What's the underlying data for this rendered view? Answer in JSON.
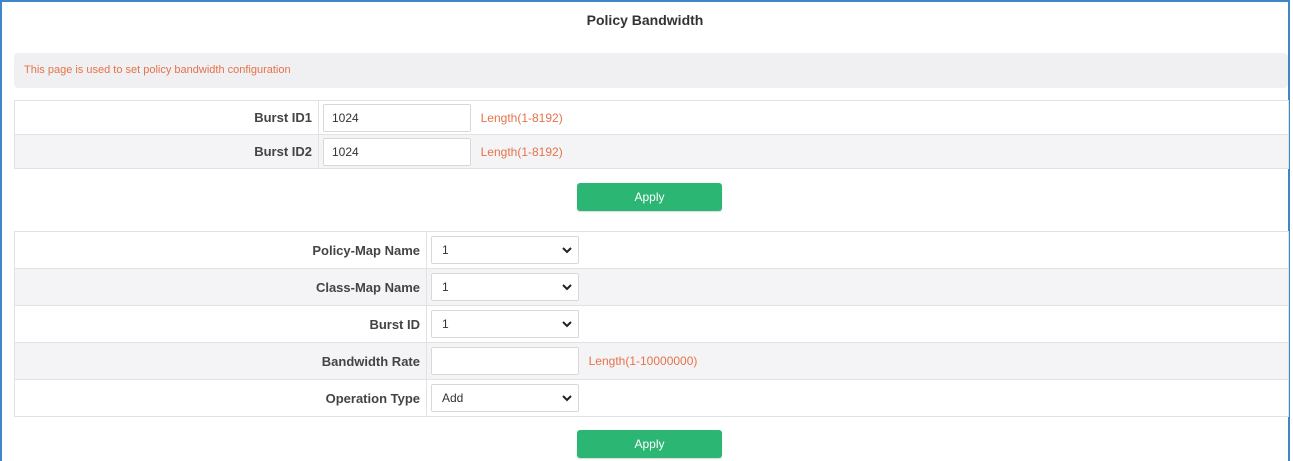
{
  "page": {
    "title": "Policy Bandwidth",
    "description": "This page is used to set policy bandwidth configuration"
  },
  "burst_form": {
    "rows": [
      {
        "label": "Burst ID1",
        "value": "1024",
        "hint": "Length(1-8192)"
      },
      {
        "label": "Burst ID2",
        "value": "1024",
        "hint": "Length(1-8192)"
      }
    ],
    "apply_label": "Apply"
  },
  "policy_form": {
    "policy_map": {
      "label": "Policy-Map Name",
      "selected": "1"
    },
    "class_map": {
      "label": "Class-Map Name",
      "selected": "1"
    },
    "burst_id": {
      "label": "Burst ID",
      "selected": "1"
    },
    "bandwidth_rate": {
      "label": "Bandwidth Rate",
      "value": "",
      "hint": "Length(1-10000000)"
    },
    "operation_type": {
      "label": "Operation Type",
      "selected": "Add"
    },
    "apply_label": "Apply"
  },
  "colors": {
    "accent_green": "#2bb673",
    "hint_orange": "#e5734a",
    "frame_blue": "#3f86c8"
  }
}
